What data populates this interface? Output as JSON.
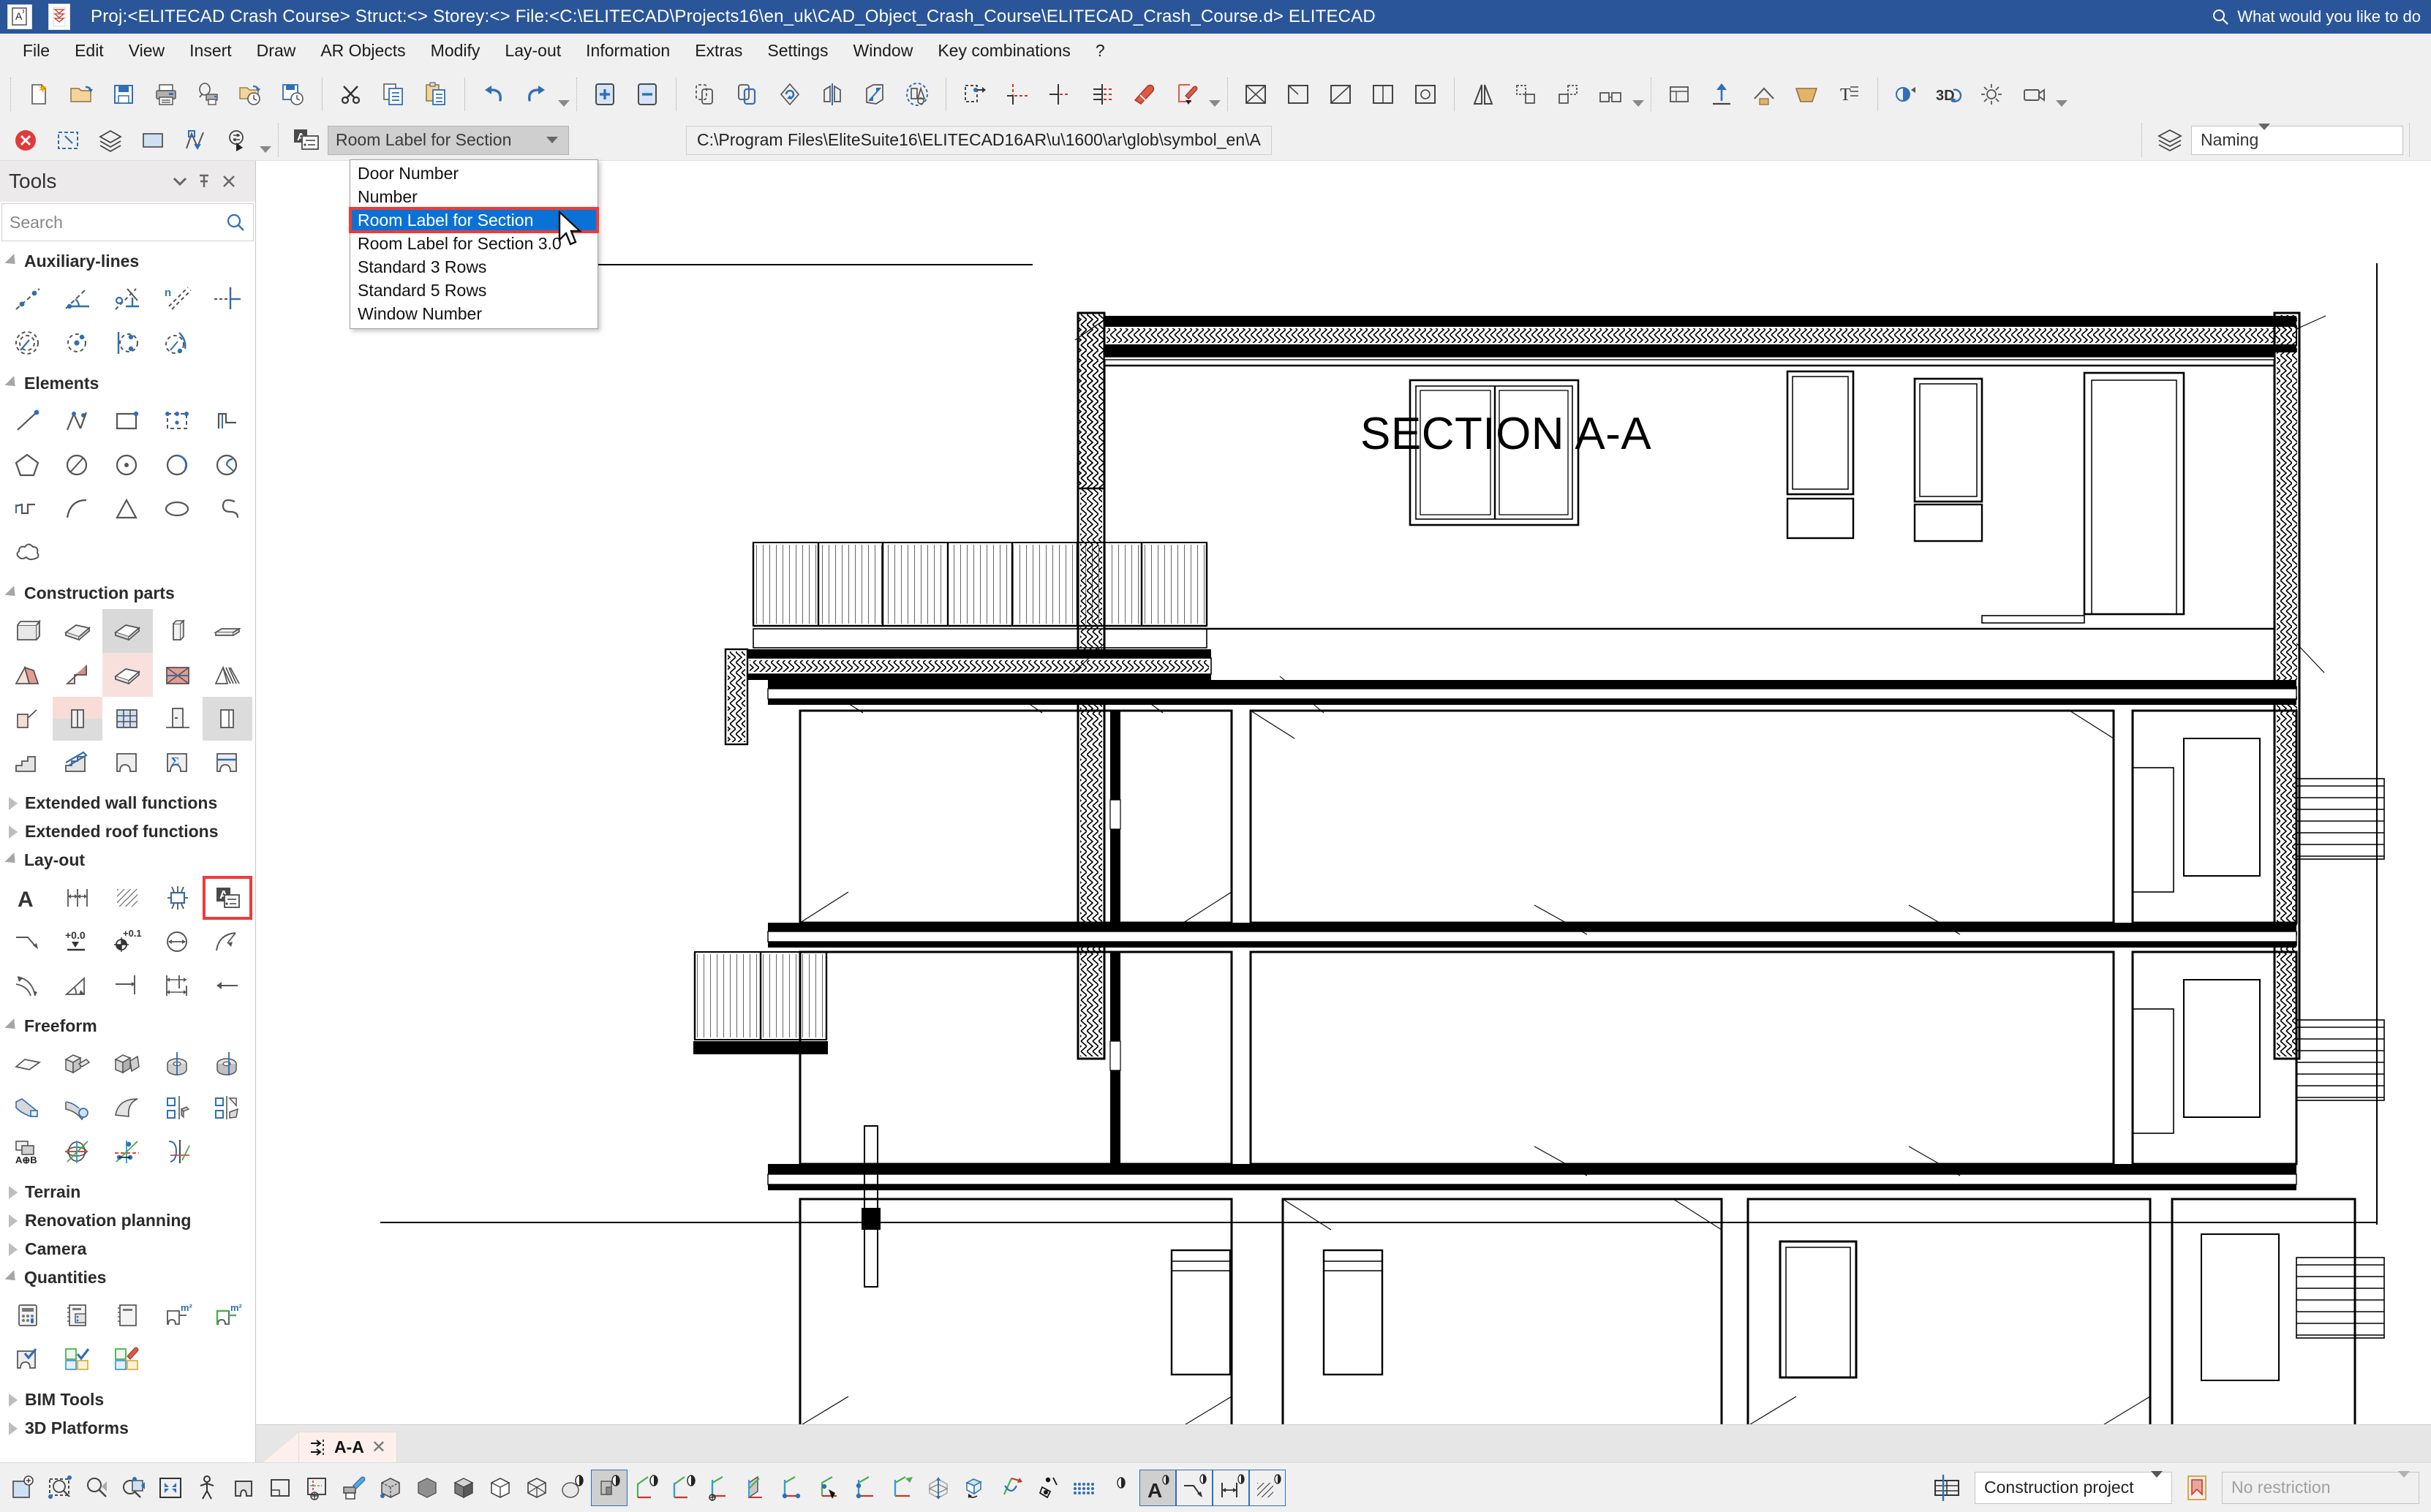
{
  "titlebar": {
    "title": "Proj:<ELITECAD Crash Course> Struct:<>  Storey:<>  File:<C:\\ELITECAD\\Projects16\\en_uk\\CAD_Object_Crash_Course\\ELITECAD_Crash_Course.d> ELITECAD",
    "search_placeholder": "What would you like to do",
    "search_icon": "search-icon",
    "app_icon": "elitecad-app-icon",
    "doc_icon": "document-icon"
  },
  "menubar": {
    "items": [
      {
        "label": "File"
      },
      {
        "label": "Edit"
      },
      {
        "label": "View"
      },
      {
        "label": "Insert"
      },
      {
        "label": "Draw"
      },
      {
        "label": "AR Objects"
      },
      {
        "label": "Modify"
      },
      {
        "label": "Lay-out"
      },
      {
        "label": "Information"
      },
      {
        "label": "Extras"
      },
      {
        "label": "Settings"
      },
      {
        "label": "Window"
      },
      {
        "label": "Key combinations"
      },
      {
        "label": "?"
      }
    ]
  },
  "toolbar2": {
    "symbol_combo_value": "Room Label for Section",
    "path_value": "C:\\Program Files\\EliteSuite16\\ELITECAD16AR\\u\\1600\\ar\\glob\\symbol_en\\A",
    "naming_value": "Naming",
    "naming_icon": "layers-icon",
    "symbol_icon": "text-label-icon",
    "close_icon": "close-icon",
    "select_icon": "select-rect-icon",
    "layer_icon": "layers-icon",
    "rect_icon": "rectangle-icon",
    "polyline_icon": "polyline-icon",
    "zoom_settings_icon": "zoom-settings-icon"
  },
  "dropdown": {
    "open": true,
    "selected": "Room Label for Section",
    "items": [
      {
        "label": "Door Number"
      },
      {
        "label": "Number"
      },
      {
        "label": "Room Label for Section"
      },
      {
        "label": "Room Label for Section 3.0"
      },
      {
        "label": "Standard 3 Rows"
      },
      {
        "label": "Standard 5 Rows"
      },
      {
        "label": "Window Number"
      }
    ],
    "highlight_color": "#0a72d4",
    "outline_color": "#ee3b3b"
  },
  "tools_panel": {
    "title": "Tools",
    "search_placeholder": "Search",
    "search_icon": "search-icon",
    "menu_icon": "chevron-down-icon",
    "pin_icon": "pin-icon",
    "close_icon": "close-icon",
    "groups": [
      {
        "label": "Auxiliary-lines",
        "expanded": true,
        "icons": [
          "auxiliary-line-point-icon",
          "auxiliary-angle-icon",
          "auxiliary-perpendicular-icon",
          "auxiliary-parallel-n-icon",
          "auxiliary-crosshair-icon",
          "auxiliary-circle-tangent-icon",
          "auxiliary-circle-center-icon",
          "auxiliary-circle-two-points-icon",
          "auxiliary-arc-icon"
        ]
      },
      {
        "label": "Elements",
        "expanded": true,
        "icons": [
          "line-icon",
          "polyline-icon",
          "rectangle-icon",
          "rectangle-points-icon",
          "step-line-icon",
          "pentagon-icon",
          "circle-tangent-icon",
          "circle-center-icon",
          "arc-three-point-icon",
          "spiral-icon",
          "freehand-icon",
          "arc-icon",
          "triangle-icon",
          "ellipse-icon",
          "s-curve-icon",
          "cloud-icon"
        ]
      },
      {
        "label": "Construction parts",
        "expanded": true,
        "icons": [
          "wall-icon",
          "slab-icon",
          "slab-highlight-icon",
          "column-icon",
          "beam-icon",
          "gable-roof-icon",
          "shed-roof-icon",
          "roof-slab-icon",
          "hip-roof-icon",
          "roof-multi-icon",
          "roof-cut-icon",
          "window-icon",
          "grid-window-icon",
          "door-icon",
          "opening-icon",
          "stairs-icon",
          "stairs-railing-icon",
          "room-icon",
          "room-sum-icon",
          "room-line-icon"
        ]
      },
      {
        "label": "Extended wall functions",
        "expanded": false,
        "icons": []
      },
      {
        "label": "Extended roof functions",
        "expanded": false,
        "icons": []
      },
      {
        "label": "Lay-out",
        "expanded": true,
        "selected_icon_index": 4,
        "icons": [
          "text-icon",
          "dimension-icon",
          "hatch-icon",
          "symbol-insert-icon",
          "room-label-icon",
          "leader-line-icon",
          "height-level-icon",
          "elevation-point-icon",
          "diameter-dim-icon",
          "radius-dim-icon",
          "arc-dimension-icon",
          "angle-dimension-icon",
          "single-dimension-icon",
          "chain-dimension-icon",
          "arrow-icon"
        ]
      },
      {
        "label": "Freeform",
        "expanded": true,
        "icons": [
          "flat-surface-icon",
          "extrude-icon",
          "extrude2-icon",
          "rotate-body-icon",
          "rotate-body2-icon",
          "sweep-icon",
          "sweep-sphere-icon",
          "curved-surface-icon",
          "section-body-icon",
          "section-body2-icon",
          "boolean-icon",
          "rotate-axis-icon",
          "move-axis-icon",
          "curve-axis-icon"
        ]
      },
      {
        "label": "Terrain",
        "expanded": false,
        "icons": []
      },
      {
        "label": "Renovation planning",
        "expanded": false,
        "icons": []
      },
      {
        "label": "Camera",
        "expanded": false,
        "icons": []
      },
      {
        "label": "Quantities",
        "expanded": true,
        "icons": [
          "calculator-icon",
          "report-list-icon",
          "report-icon",
          "area-m2-icon",
          "area-m2-green-icon",
          "room-check-icon",
          "rooms-check-icon",
          "rooms-edit-icon"
        ]
      },
      {
        "label": "BIM Tools",
        "expanded": false,
        "icons": []
      },
      {
        "label": "3D Platforms",
        "expanded": false,
        "icons": []
      }
    ]
  },
  "canvas": {
    "section_title": "SECTION A-A",
    "drawing_name": "building-section-drawing"
  },
  "tabs": {
    "items": [
      {
        "label": "A-A",
        "close_icon": "close-icon",
        "active": true
      }
    ]
  },
  "statusbar": {
    "construction_project": "Construction project",
    "restriction": "No restriction",
    "grid_icon": "grid-storey-icon",
    "restriction_icon": "restriction-icon",
    "left_icons": [
      "zoom-window-icon",
      "zoom-rect-icon",
      "zoom-out-icon",
      "zoom-previous-icon",
      "zoom-all-icon",
      "walk-through-icon",
      "room-view-icon",
      "window-view-icon",
      "crosshair-view-icon",
      "print-preview-icon",
      "box-dashed-icon",
      "shade-solid-icon",
      "shade-side-icon",
      "wireframe-hidden-icon",
      "wireframe-icon",
      "render-sphere-icon",
      "render-solid-icon",
      "render-axes-icon",
      "axo-view-icon",
      "axis-origin-icon",
      "plane-view-icon",
      "axis-xy-icon",
      "axis-arrow-icon",
      "axis-xz-icon",
      "axis-yz-icon",
      "3d-move-icon",
      "3d-box-icon",
      "rotate-object-icon",
      "rotate-view-icon",
      "rotate-point-icon",
      "dot-grid-icon",
      "text-toggle-icon",
      "leader-toggle-icon",
      "dim-toggle-icon",
      "hatch-toggle-icon"
    ]
  },
  "colors": {
    "titlebar_bg": "#2a5699",
    "chrome_bg": "#f0f0f0",
    "panel_bg": "#ffffff",
    "accent_blue": "#0a72d4",
    "highlight_red": "#ee3b3b",
    "tab_bg": "#fdf0ec"
  }
}
